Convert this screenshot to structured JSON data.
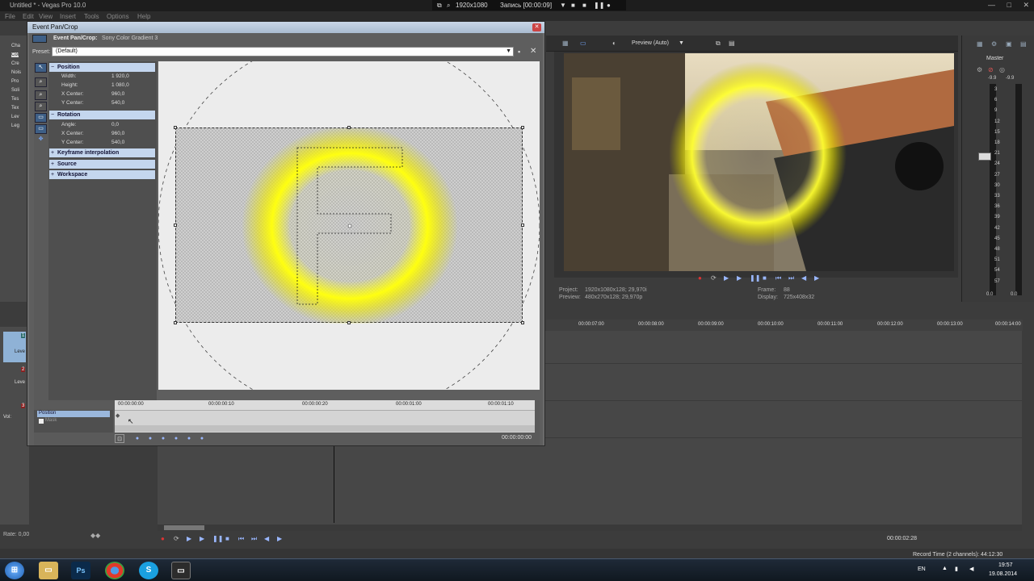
{
  "app": {
    "title": "Untitled * - Vegas Pro 10.0",
    "menu": [
      "File",
      "Edit",
      "View",
      "Insert",
      "Tools",
      "Options",
      "Help"
    ],
    "recording": {
      "resolution": "1920x1080",
      "status": "Запись [00:00:09]"
    },
    "left_items": [
      "Cha",
      "Col",
      "Cre",
      "Nois",
      "Pro",
      "Soli",
      "Tes",
      "Tex",
      "Lev",
      "Leg"
    ]
  },
  "dialog": {
    "title": "Event Pan/Crop",
    "event_label": "Event Pan/Crop:",
    "event_name": "Sony Color Gradient 3",
    "preset_label": "Preset:",
    "preset_value": "(Default)",
    "sections": {
      "position": "Position",
      "rotation": "Rotation",
      "keyframe": "Keyframe interpolation",
      "source": "Source",
      "workspace": "Workspace"
    },
    "position_props": [
      {
        "k": "Width:",
        "v": "1 920,0"
      },
      {
        "k": "Height:",
        "v": "1 080,0"
      },
      {
        "k": "X Center:",
        "v": "960,0"
      },
      {
        "k": "Y Center:",
        "v": "540,0"
      }
    ],
    "rotation_props": [
      {
        "k": "Angle:",
        "v": "0,0"
      },
      {
        "k": "X Center:",
        "v": "960,0"
      },
      {
        "k": "Y Center:",
        "v": "540,0"
      }
    ],
    "ruler_ticks": [
      "00:00:00:00",
      "00:00:00:10",
      "00:00:00:20",
      "00:00:01:00",
      "00:00:01:10"
    ],
    "kf_rows": {
      "position": "Position",
      "mask": "Mask"
    },
    "kf_time": "00:00:00:00"
  },
  "preview": {
    "mode": "Preview (Auto)",
    "project_label": "Project:",
    "project_value": "1920x1080x128; 29,970i",
    "preview_label": "Preview:",
    "preview_value": "480x270x128; 29,970p",
    "frame_label": "Frame:",
    "frame_value": "88",
    "display_label": "Display:",
    "display_value": "725x408x32"
  },
  "mixer": {
    "label": "Master",
    "scale": [
      "3",
      "6",
      "9",
      "12",
      "15",
      "18",
      "21",
      "24",
      "27",
      "30",
      "33",
      "36",
      "39",
      "42",
      "45",
      "48",
      "51",
      "54",
      "57"
    ],
    "levels": [
      "0.0",
      "0.0"
    ],
    "peak": [
      "-9.9",
      "-9.9"
    ]
  },
  "timeline": {
    "ticks": [
      "00:00:07:00",
      "00:00:08:00",
      "00:00:09:00",
      "00:00:10:00",
      "00:00:11:00",
      "00:00:12:00",
      "00:00:13:00",
      "00:00:14:00"
    ],
    "track_labels": [
      "Leve",
      "Leve",
      "Vol:"
    ],
    "track_numbers": [
      "1",
      "2",
      "3"
    ],
    "rate": "Rate: 0,00",
    "cursor_time": "00:00:02:28",
    "record_time": "Record Time (2 channels): 44:12:30"
  },
  "taskbar": {
    "lang": "EN",
    "time": "19:57",
    "date": "19.08.2014"
  }
}
